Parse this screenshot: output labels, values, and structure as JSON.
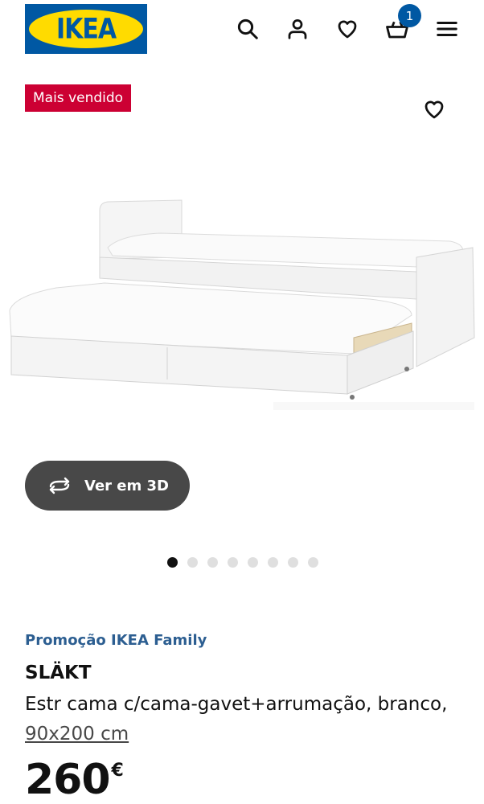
{
  "header": {
    "logo_text": "IKEA",
    "cart_count": "1"
  },
  "product": {
    "badge": "Mais vendido",
    "view_3d_label": "Ver em 3D",
    "promo": "Promoção IKEA Family",
    "name": "SLÄKT",
    "description": "Estr cama c/cama-gavet+arrumação, branco,",
    "size": "90x200 cm",
    "price": "260",
    "currency": "€"
  },
  "carousel": {
    "total": 8,
    "active": 1
  },
  "colors": {
    "brand_blue": "#0058a3",
    "brand_yellow": "#ffdb00",
    "badge_red": "#cc0033",
    "promo_blue": "#2c5e91"
  }
}
